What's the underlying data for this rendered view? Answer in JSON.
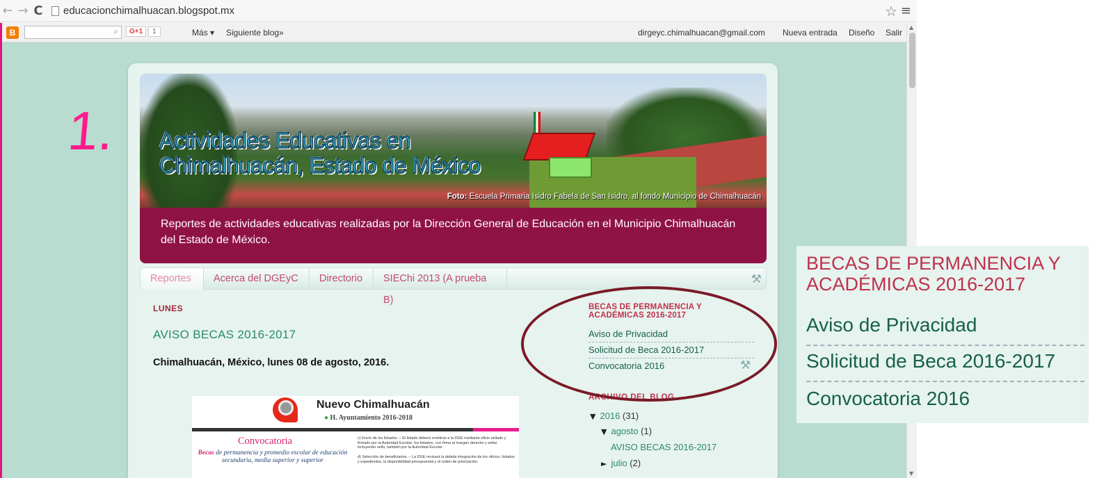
{
  "browser": {
    "url": "educacionchimalhuacan.blogspot.mx",
    "back_icon": "←",
    "forward_icon": "→",
    "reload_icon": "C",
    "star_icon": "☆",
    "menu_icon": "≡"
  },
  "blogger_bar": {
    "logo": "B",
    "gplus": "G+1",
    "gplus_count": "1",
    "mas": "Más ▾",
    "siguiente": "Siguiente blog»",
    "email": "dirgeyc.chimalhuacan@gmail.com",
    "nueva_entrada": "Nueva entrada",
    "diseno": "Diseño",
    "salir": "Salir"
  },
  "annotation": {
    "number": "1."
  },
  "header": {
    "title_line1": "Actividades Educativas en",
    "title_line2": "Chimalhuacán, Estado de México",
    "photo_credit_bold": "Foto:",
    "photo_credit_text": " Escuela Primaria Isidro Fabela de San Isidro, al fondo Municipio de Chimalhuacán",
    "description": "Reportes de actividades educativas realizadas por la Dirección General de Educación en el Municipio Chimalhuacán del Estado de México."
  },
  "tabs": [
    {
      "label": "Reportes"
    },
    {
      "label": "Acerca del DGEyC"
    },
    {
      "label": "Directorio"
    },
    {
      "label": "SIEChi 2013 (A prueba B)"
    }
  ],
  "post": {
    "date_header": "LUNES",
    "title": "AVISO BECAS 2016-2017",
    "body": "Chimalhuacán, México, lunes 08 de agosto, 2016.",
    "image": {
      "brand": "Nuevo Chimalhuacán",
      "bullet": "●",
      "subtitle": "H. Ayuntamiento 2016-2018",
      "heading": "Convocatoria",
      "becas_bold": "Becas",
      "becas_text": " de permanencia y promedio escolar de educación secundaria, media superior y superior",
      "small1": "c)  Envío de los listados. – El listado deberá remitirse a la DGE mediante oficio sellado y firmado por la Autoridad Escolar; los listados, con firma al margen derecho y sellar incluyendo sello, también por la Autoridad Escolar.",
      "small2": "d)  Selección de beneficiarios. – La DGE revisará la debida integración de los oficios, listados y expedientes, la disponibilidad presupuestal y el orden de priorización."
    }
  },
  "sidebar": {
    "becas_title": "BECAS DE PERMANENCIA Y ACADÉMICAS 2016-2017",
    "links": [
      {
        "label": "Aviso de Privacidad"
      },
      {
        "label": "Solicitud de Beca 2016-2017"
      },
      {
        "label": "Convocatoria 2016"
      }
    ],
    "archive_title": "ARCHIVO DEL BLOG",
    "archive": {
      "year_arrow": "▼",
      "year": "2016",
      "year_count": "(31)",
      "month_arrow": "▼",
      "month": "agosto",
      "month_count": "(1)",
      "post": "AVISO BECAS 2016-2017",
      "prev_arrow": "►",
      "prev_month": "julio",
      "prev_count": "(2)"
    }
  },
  "zoom": {
    "title": "BECAS DE PERMANENCIA Y ACADÉMICAS 2016-2017",
    "links": [
      {
        "label": "Aviso de Privacidad"
      },
      {
        "label": "Solicitud de Beca 2016-2017"
      },
      {
        "label": "Convocatoria 2016"
      }
    ]
  },
  "colors": {
    "page_bg": "#b9dcd0",
    "description_bar": "#8f1245",
    "title_accent": "#c0304d",
    "link": "#17604a",
    "annotation": "#ff1a8c",
    "circle": "#7a1a28"
  }
}
